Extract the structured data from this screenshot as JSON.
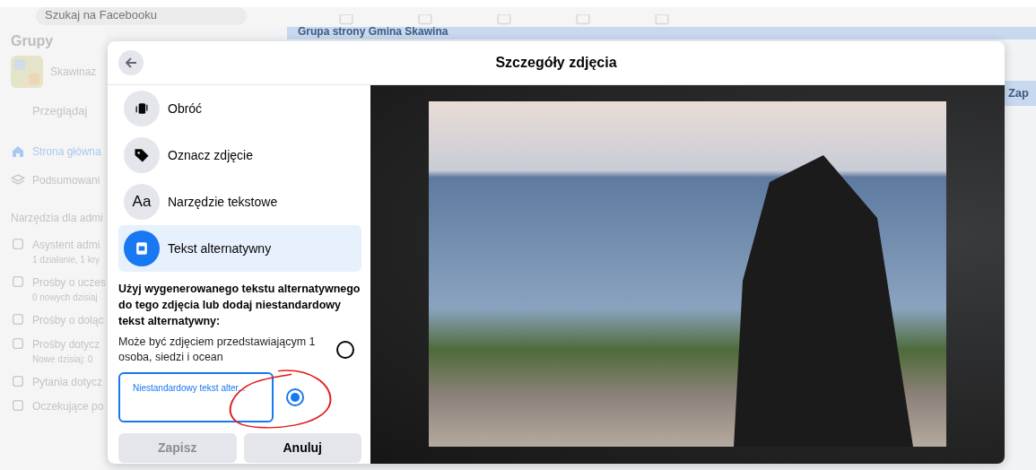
{
  "search": {
    "placeholder": "Szukaj na Facebooku"
  },
  "sidebar": {
    "title": "Grupy",
    "group_name": "Skawinaz",
    "browse": "Przeglądaj",
    "items": [
      {
        "label": "Strona główna",
        "selected": true
      },
      {
        "label": "Podsumowani",
        "selected": false
      }
    ],
    "admin_heading": "Narzędzia dla admi",
    "admin_items": [
      {
        "label": "Asystent admi",
        "sub": "1 działanie, 1 kry"
      },
      {
        "label": "Prośby o uczes",
        "sub": "0 nowych dzisiaj"
      },
      {
        "label": "Prośby o dołąc"
      },
      {
        "label": "Prośby dotycz",
        "sub": "Nowe dzisiaj: 0"
      },
      {
        "label": "Pytania dotycz"
      },
      {
        "label": "Oczekujące po"
      }
    ]
  },
  "banner": "Grupa strony Gmina Skawina",
  "side_button": "Zap",
  "dialog": {
    "title": "Szczegóły zdjęcia",
    "tools": [
      {
        "label": "Obróć",
        "kind": "rotate",
        "selected": false
      },
      {
        "label": "Oznacz zdjęcie",
        "kind": "tag",
        "selected": false
      },
      {
        "label": "Narzędzie tekstowe",
        "kind": "text",
        "icon_text": "Aa",
        "selected": false
      },
      {
        "label": "Tekst alternatywny",
        "kind": "alt",
        "selected": true
      }
    ],
    "description": "Użyj wygenerowanego tekstu alternatywnego do tego zdjęcia lub dodaj niestandardowy tekst alternatywny:",
    "options": [
      {
        "kind": "generated",
        "text": "Może być zdjęciem przedstawiającym 1 osoba, siedzi i ocean",
        "selected": false
      },
      {
        "kind": "custom",
        "label": "Niestandardowy tekst alter...",
        "selected": true
      }
    ],
    "buttons": [
      {
        "label": "Zapisz",
        "disabled": true
      },
      {
        "label": "Anuluj",
        "disabled": false
      }
    ]
  }
}
